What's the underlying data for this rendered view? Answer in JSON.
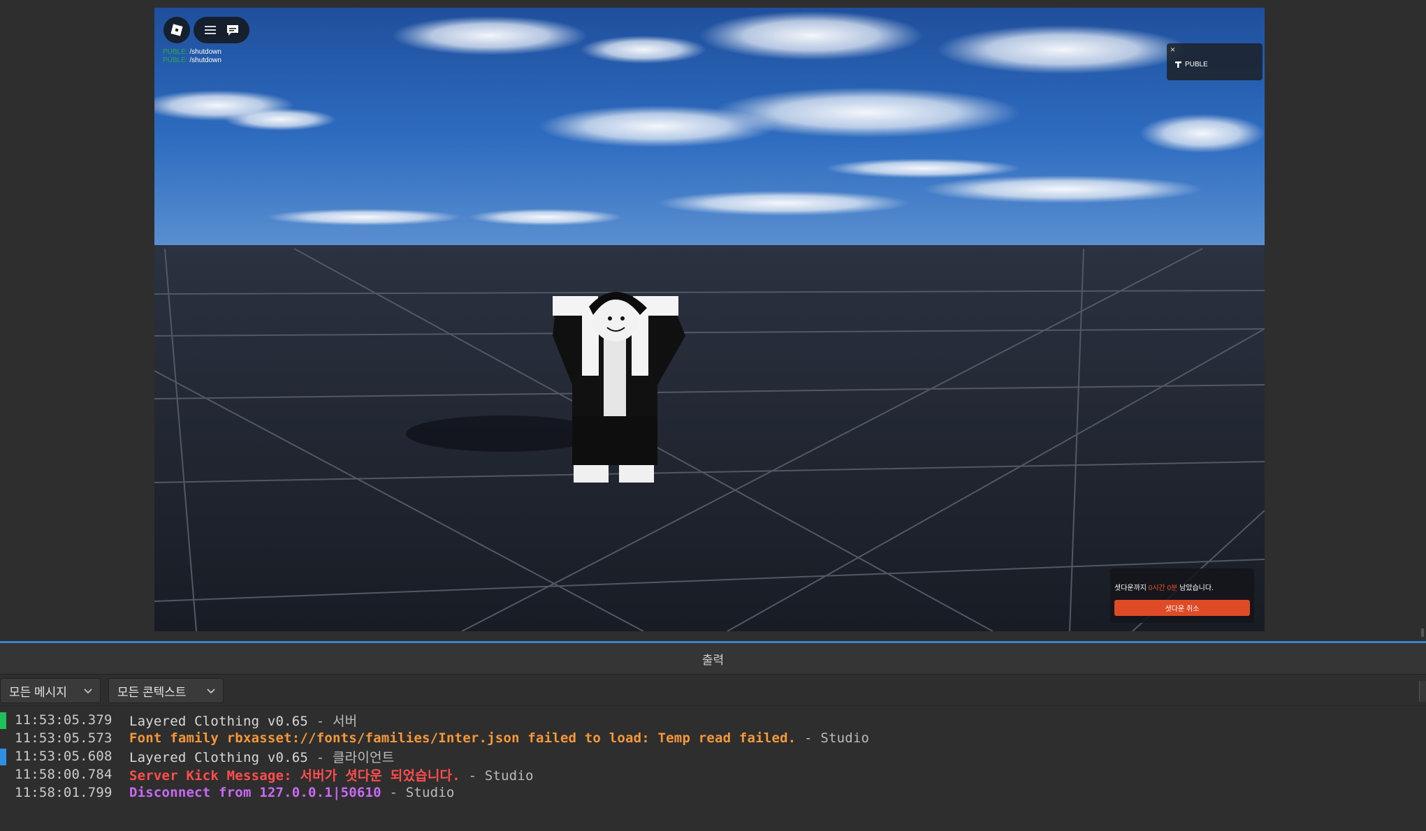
{
  "colors": {
    "accent_blue": "#3a86c8",
    "warn": "#f5983a",
    "error": "#ff4d4d",
    "info": "#c96af5",
    "server_marker": "#1fbf5a",
    "client_marker": "#2f8fe0",
    "shutdown_button": "#e04b27"
  },
  "game": {
    "chat": [
      {
        "tag": "PUBLE:",
        "text": "/shutdown"
      },
      {
        "tag": "PUBLE:",
        "text": "/shutdown"
      }
    ],
    "puble_panel": {
      "close": "×",
      "label": "PUBLE"
    },
    "shutdown": {
      "text_prefix": "셧다운까지",
      "text_time": "0시간 0분",
      "text_suffix": "남았습니다.",
      "cancel_label": "셧다운 취소"
    },
    "icons": {
      "roblox": "roblox-logo-icon",
      "menu": "hamburger-icon",
      "chat": "chat-icon"
    }
  },
  "output": {
    "title": "출력",
    "filters": {
      "messages": "모든 메시지",
      "context": "모든 콘텍스트"
    },
    "logs": [
      {
        "marker": "server",
        "time": "11:53:05.379",
        "message": "Layered Clothing v0.65",
        "type": "normal",
        "source": "서버"
      },
      {
        "marker": "",
        "time": "11:53:05.573",
        "message": "Font family rbxasset://fonts/families/Inter.json failed to load: Temp read failed.",
        "type": "warn",
        "source": "Studio"
      },
      {
        "marker": "client",
        "time": "11:53:05.608",
        "message": "Layered Clothing v0.65",
        "type": "normal",
        "source": "클라이언트"
      },
      {
        "marker": "",
        "time": "11:58:00.784",
        "message": "Server Kick Message: 서버가 셧다운 되었습니다.",
        "type": "error",
        "source": "Studio"
      },
      {
        "marker": "",
        "time": "11:58:01.799",
        "message": "Disconnect from 127.0.0.1|50610",
        "type": "info",
        "source": "Studio"
      }
    ]
  }
}
